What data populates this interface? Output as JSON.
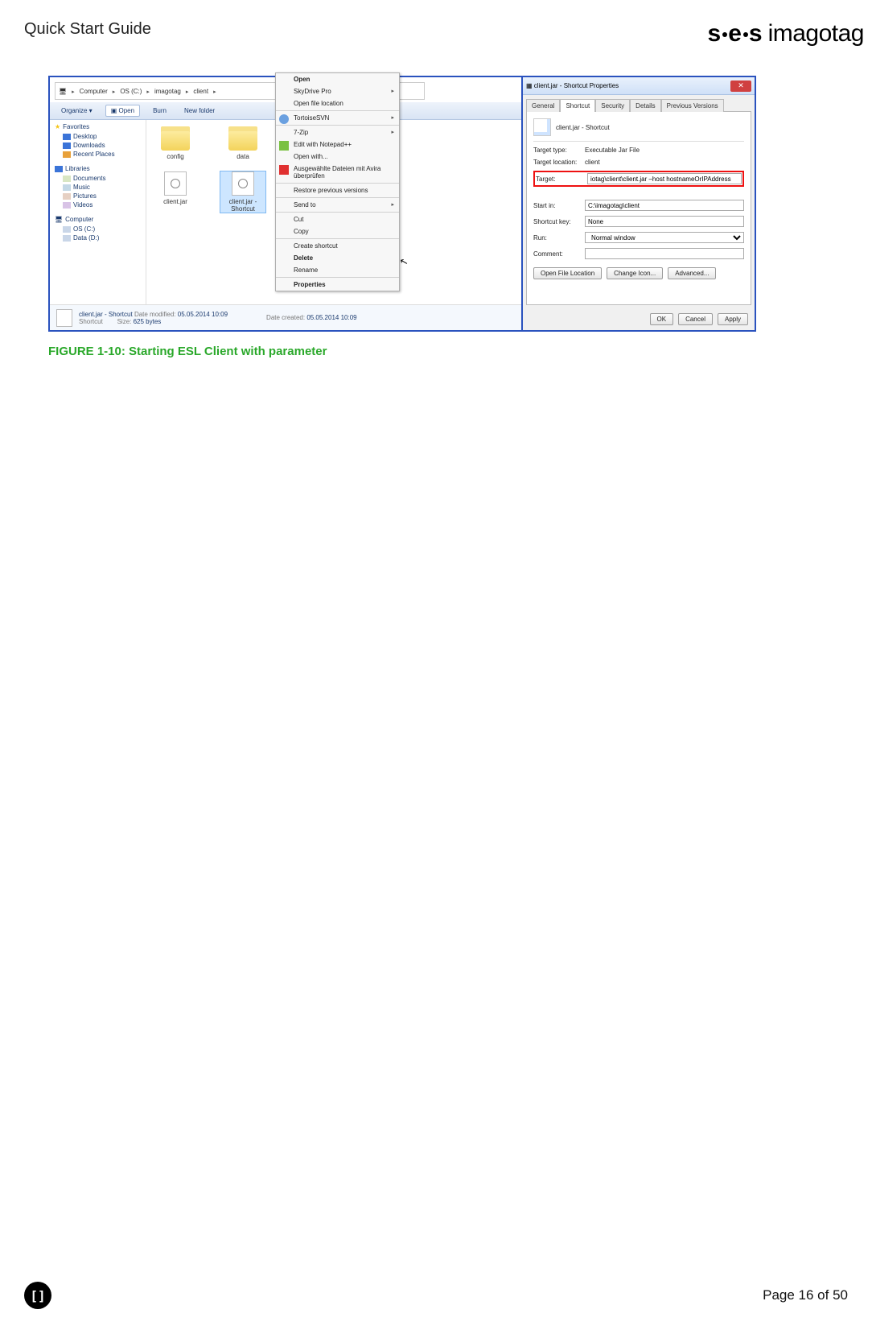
{
  "header": {
    "title": "Quick Start Guide",
    "logo_bold": "ses",
    "logo_light": "imagotag"
  },
  "figure": {
    "caption": "FIGURE 1-10: Starting ESL Client with parameter"
  },
  "explorer": {
    "breadcrumb": [
      "Computer",
      "OS (C:)",
      "imagotag",
      "client"
    ],
    "toolbar": {
      "organize": "Organize ▾",
      "open": "Open",
      "burn": "Burn",
      "newfolder": "New folder"
    },
    "nav": {
      "favorites": "Favorites",
      "desktop": "Desktop",
      "downloads": "Downloads",
      "recent": "Recent Places",
      "libraries": "Libraries",
      "documents": "Documents",
      "music": "Music",
      "pictures": "Pictures",
      "videos": "Videos",
      "computer": "Computer",
      "osc": "OS (C:)",
      "datad": "Data (D:)"
    },
    "files": {
      "config": "config",
      "data": "data",
      "clientjar": "client.jar",
      "shortcut": "client.jar - Shortcut"
    },
    "status": {
      "name": "client.jar - Shortcut",
      "type": "Shortcut",
      "mod_label": "Date modified:",
      "mod": "05.05.2014 10:09",
      "size_label": "Size:",
      "size": "625 bytes",
      "created_label": "Date created:",
      "created": "05.05.2014 10:09"
    }
  },
  "context_menu": {
    "open": "Open",
    "skydrive": "SkyDrive Pro",
    "openloc": "Open file location",
    "tortoise": "TortoiseSVN",
    "sevenzip": "7-Zip",
    "notepadpp": "Edit with Notepad++",
    "openwith": "Open with...",
    "avira": "Ausgewählte Dateien mit Avira überprüfen",
    "restore": "Restore previous versions",
    "sendto": "Send to",
    "cut": "Cut",
    "copy": "Copy",
    "createshortcut": "Create shortcut",
    "delete": "Delete",
    "rename": "Rename",
    "properties": "Properties"
  },
  "props": {
    "title": "client.jar - Shortcut Properties",
    "tabs": {
      "general": "General",
      "shortcut": "Shortcut",
      "security": "Security",
      "details": "Details",
      "prev": "Previous Versions"
    },
    "name": "client.jar - Shortcut",
    "target_type_label": "Target type:",
    "target_type": "Executable Jar File",
    "target_loc_label": "Target location:",
    "target_loc": "client",
    "target_label": "Target:",
    "target": "iotag\\client\\client.jar –host hostnameOrIPAddress",
    "startin_label": "Start in:",
    "startin": "C:\\imagotag\\client",
    "shortcutkey_label": "Shortcut key:",
    "shortcutkey": "None",
    "run_label": "Run:",
    "run": "Normal window",
    "comment_label": "Comment:",
    "buttons": {
      "openloc": "Open File Location",
      "changeicon": "Change Icon...",
      "advanced": "Advanced..."
    },
    "dlg": {
      "ok": "OK",
      "cancel": "Cancel",
      "apply": "Apply"
    }
  },
  "footer": {
    "badge": "[]",
    "page": "Page 16 of 50"
  }
}
